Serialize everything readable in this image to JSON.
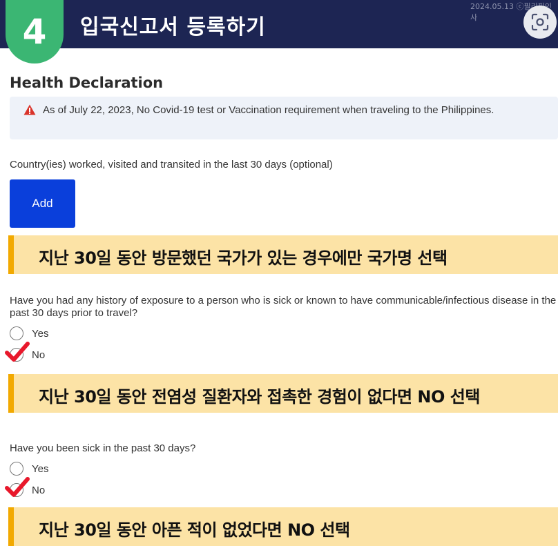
{
  "header": {
    "step_number": "4",
    "title": "입국신고서 등록하기",
    "watermark": "2024.05.13 ⓒ필리핀인사"
  },
  "form": {
    "section_title": "Health Declaration",
    "alert_text": "As of July 22, 2023, No Covid-19 test or Vaccination requirement when traveling to the Philippines.",
    "countries_question": "Country(ies) worked, visited and transited in the last 30 days (optional)",
    "add_button_label": "Add",
    "exposure_question": "Have you had any history of exposure to a person who is sick or known to have communicable/infectious disease in the past 30 days prior to travel?",
    "exposure_options": [
      {
        "label": "Yes",
        "selected": false
      },
      {
        "label": "No",
        "selected": true
      }
    ],
    "sick_question": "Have you been sick in the past 30 days?",
    "sick_options": [
      {
        "label": "Yes",
        "selected": false
      },
      {
        "label": "No",
        "selected": true
      }
    ]
  },
  "callouts": [
    "지난 30일 동안 방문했던 국가가 있는 경우에만 국가명 선택",
    "지난 30일 동안 전염성 질환자와 접촉한 경험이 없다면 NO 선택",
    "지난 30일 동안 아픈 적이 없었다면 NO 선택"
  ],
  "icons": {
    "lens": "image-search-icon",
    "alert": "warning-triangle-icon",
    "check": "checkmark-icon"
  },
  "colors": {
    "header_bg": "#1d2553",
    "badge": "#3bb673",
    "button": "#0a3fdb",
    "callout_bg": "#fce3a6",
    "callout_accent": "#f2a900",
    "check": "#e8182b"
  }
}
